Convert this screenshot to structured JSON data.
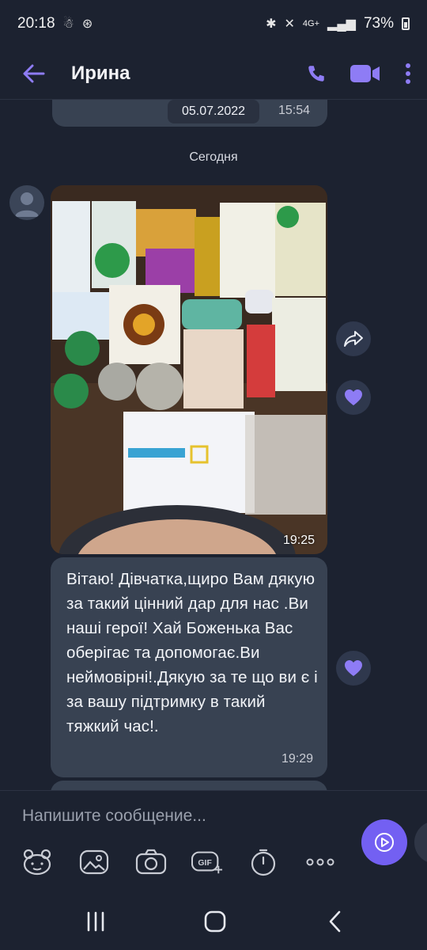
{
  "status_bar": {
    "time": "20:18",
    "network": "4G+",
    "battery": "73%"
  },
  "header": {
    "contact_name": "Ирина"
  },
  "previous_message": {
    "date": "05.07.2022",
    "time": "15:54"
  },
  "day_separator": "Сегодня",
  "photo_message": {
    "time": "19:25"
  },
  "text_message": {
    "text": "Вітаю! Дівчатка,щиро Вам дякую за такий цінний дар для нас .Ви наші герої! Хай Боженька Вас оберігає та допомогає.Ви неймовірні!.Дякую за те що ви є і за вашу підтримку в такий тяжкий час!.",
    "time": "19:29"
  },
  "composer": {
    "placeholder": "Напишите сообщение..."
  },
  "colors": {
    "accent": "#7360f2",
    "background": "#1c2230",
    "bubble": "#384252"
  },
  "icons": [
    "back-arrow-icon",
    "phone-icon",
    "video-camera-icon",
    "more-vertical-icon",
    "forward-icon",
    "heart-icon",
    "sticker-icon",
    "gallery-icon",
    "camera-icon",
    "gif-icon",
    "timer-icon",
    "more-horizontal-icon",
    "send-icon",
    "recents-icon",
    "home-icon",
    "nav-back-icon"
  ]
}
